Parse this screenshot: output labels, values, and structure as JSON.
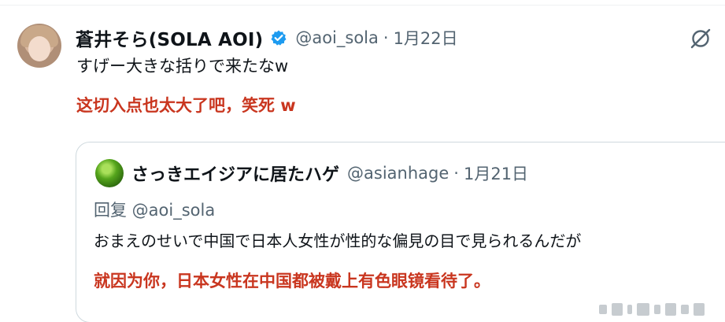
{
  "tweet": {
    "display_name": "蒼井そら(SOLA AOI)",
    "handle": "@aoi_sola",
    "separator": "·",
    "date": "1月22日",
    "text": "すげー大きな括りで来たなw",
    "verified_icon": "verified-badge-icon",
    "more_icon": "grok-icon"
  },
  "annotation_1": "这切入点也太大了吧，笑死 w",
  "quoted_tweet": {
    "display_name": "さっきエイジアに居たハゲ",
    "handle": "@asianhage",
    "separator": "·",
    "date": "1月21日",
    "reply_to": "回复 @aoi_sola",
    "text": "おまえのせいで中国で日本人女性が性的な偏見の目で見られるんだが"
  },
  "annotation_2": "就因为你，日本女性在中国都被戴上有色眼镜看待了。",
  "colors": {
    "text": "#0f1419",
    "muted": "#536471",
    "annotation": "#c9361f",
    "verified": "#1d9bf0",
    "border": "#cfd9de"
  }
}
